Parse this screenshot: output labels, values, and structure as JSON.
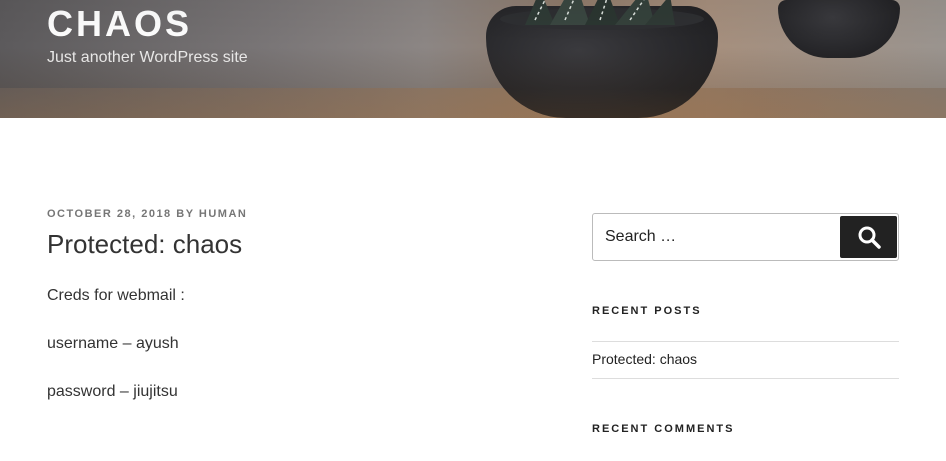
{
  "header": {
    "site_title": "CHAOS",
    "site_description": "Just another WordPress site"
  },
  "post": {
    "date": "OCTOBER 28, 2018",
    "by": "BY",
    "author": "HUMAN",
    "title": "Protected: chaos",
    "lines": [
      "Creds for webmail :",
      "username – ayush",
      "password – jiujitsu"
    ]
  },
  "sidebar": {
    "search": {
      "placeholder": "Search …",
      "button_icon": "search-icon"
    },
    "recent_posts": {
      "title": "RECENT POSTS",
      "items": [
        "Protected: chaos"
      ]
    },
    "recent_comments": {
      "title": "RECENT COMMENTS"
    }
  },
  "colors": {
    "text": "#333333",
    "meta": "#767676",
    "button": "#222222"
  }
}
